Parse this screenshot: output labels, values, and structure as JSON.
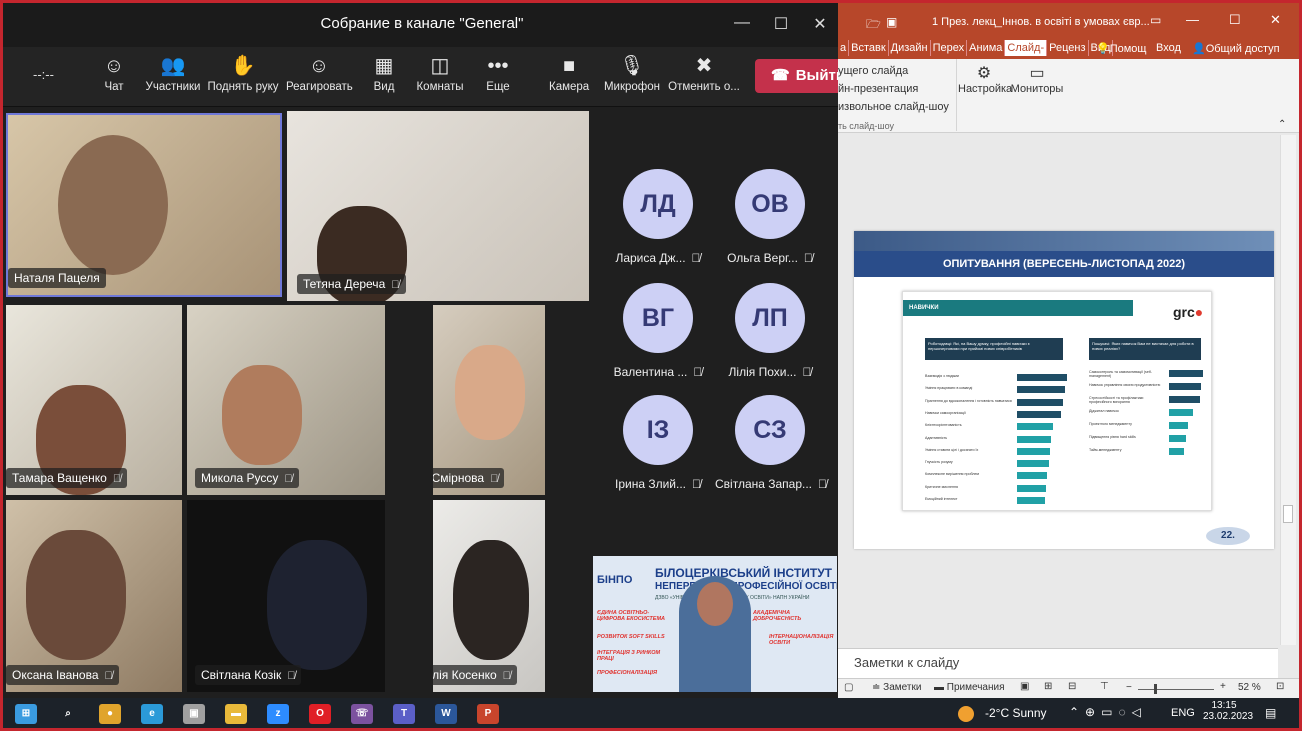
{
  "teams": {
    "window_title": "Собрание в канале \"General\"",
    "timer": "--:--",
    "toolbar": [
      {
        "icon": "chat-icon",
        "glyph": "☺",
        "label": "Чат"
      },
      {
        "icon": "participants-icon",
        "glyph": "👥",
        "label": "Участники"
      },
      {
        "icon": "raise-hand-icon",
        "glyph": "✋",
        "label": "Поднять руку"
      },
      {
        "icon": "react-icon",
        "glyph": "☺",
        "label": "Реагировать"
      },
      {
        "icon": "view-icon",
        "glyph": "▦",
        "label": "Вид"
      },
      {
        "icon": "rooms-icon",
        "glyph": "◫",
        "label": "Комнаты"
      },
      {
        "icon": "more-icon",
        "glyph": "•••",
        "label": "Еще"
      },
      {
        "icon": "camera-icon",
        "glyph": "■",
        "label": "Камера"
      },
      {
        "icon": "microphone-icon",
        "glyph": "🎙",
        "label": "Микрофон"
      },
      {
        "icon": "share-cancel-icon",
        "glyph": "✖",
        "label": "Отменить о..."
      }
    ],
    "leave_label": "Выйти",
    "video_tiles": [
      {
        "name": "Наталя Пацеля",
        "muted": false
      },
      {
        "name": "Тетяна Дереча",
        "muted": true
      },
      {
        "name": "Тамара Ващенко",
        "muted": true
      },
      {
        "name": "Микола Руссу",
        "muted": true
      },
      {
        "name": "Інна Смірнова",
        "muted": true
      },
      {
        "name": "Оксана Іванова",
        "muted": true
      },
      {
        "name": "Світлана Козік",
        "muted": true
      },
      {
        "name": "Наталія Косенко",
        "muted": true
      }
    ],
    "avatars": [
      {
        "initials": "ЛД",
        "name": "Лариса Дж..."
      },
      {
        "initials": "ОВ",
        "name": "Ольга Верг..."
      },
      {
        "initials": "ВГ",
        "name": "Валентина ..."
      },
      {
        "initials": "ЛП",
        "name": "Лілія Похи..."
      },
      {
        "initials": "ІЗ",
        "name": "Ірина Злий..."
      },
      {
        "initials": "СЗ",
        "name": "Світлана Запар..."
      }
    ],
    "presenter_banner": {
      "logo": "БІНПО",
      "title_1": "БІЛОЦЕРКІВСЬКИЙ ІНСТИТУТ",
      "title_2": "НЕПЕРЕРВНОЇ ПРОФЕСІЙНОЇ ОСВІТИ",
      "subtitle": "ДЗВО «УНІВЕРСИТЕТ МЕНЕДЖМЕНТУ ОСВІТИ» НАПН УКРАЇНИ",
      "tags": [
        "ЄДИНА ОСВІТНЬО-ЦИФРОВА ЕКОСИСТЕМА",
        "АКАДЕМІЧНА ДОБРОЧЕСНІСТЬ",
        "РОЗВИТОК SOFT SKILLS",
        "ІНТЕРНАЦІОНАЛІЗАЦІЯ ОСВІТИ",
        "ІНТЕГРАЦІЯ З РИНКОМ ПРАЦІ",
        "ПРОФЕСІОНАЛІЗАЦІЯ"
      ]
    }
  },
  "ppt": {
    "title": "1 През. лекц_Іннов. в освіті в умовах євр...",
    "tabs": [
      "а",
      "Вставк",
      "Дизайн",
      "Перех",
      "Анима",
      "Слайд-",
      "Реценз",
      "Вид"
    ],
    "help": "Помощ",
    "login": "Вход",
    "share": "Общий доступ",
    "ribbon_items": [
      "ущего слайда",
      "йн-презентация",
      "извольное слайд-шоу",
      "ть слайд-шоу"
    ],
    "ribbon_btns": [
      "Настройка",
      "Мониторы"
    ],
    "slide": {
      "header": "ОПИТУВАННЯ (ВЕРЕСЕНЬ-ЛИСТОПАД 2022)",
      "section": "НАВИЧКИ",
      "brand": "grc",
      "q_left": "Роботодавці: Які, на Вашу думку, професійні навички є першочерговими при прийомі нових співробітників",
      "q_right": "Пошукачі: Яких навичок Вам не вистачає для роботи в нових реаліях?",
      "left_items": [
        "Взаємодія з людьми",
        "Уміння працювати в команді",
        "Прагнення до вдосконалення і готовність навчатися",
        "Навички самоорганізації",
        "Клієнтоорієнтованість",
        "Адаптивність",
        "Уміння ставити цілі і досягати їх",
        "Гнучкість розуму",
        "Комплексне вирішення проблем",
        "Критичне мислення",
        "Емоційний інтелект"
      ],
      "left_values": [
        100,
        96,
        92,
        88,
        72,
        68,
        66,
        64,
        60,
        58,
        56
      ],
      "right_items": [
        "Самоконтроль та самомотивації (self-management)",
        "Навичок управління своєю продуктивністю",
        "Стресостійкості та профілактики професійного вигорання",
        "Діджитал навичок",
        "Проектного менеджменту",
        "Підвищення рівня hard skills",
        "Тайм-менеджменту"
      ],
      "right_values": [
        100,
        95,
        90,
        70,
        55,
        50,
        45
      ],
      "page": "22."
    },
    "notes": "Заметки к слайду",
    "status": {
      "notes_btn": "Заметки",
      "comments_btn": "Примечания",
      "zoom": "52 %"
    }
  },
  "taskbar": {
    "apps": [
      "windows-icon",
      "search-icon",
      "chrome-icon",
      "edge-icon",
      "app-icon",
      "explorer-icon",
      "zoom-icon",
      "opera-icon",
      "viber-icon",
      "teams-icon",
      "word-icon",
      "powerpoint-icon"
    ],
    "weather": "-2°C  Sunny",
    "lang": "ENG",
    "time": "13:15",
    "date": "23.02.2023"
  }
}
